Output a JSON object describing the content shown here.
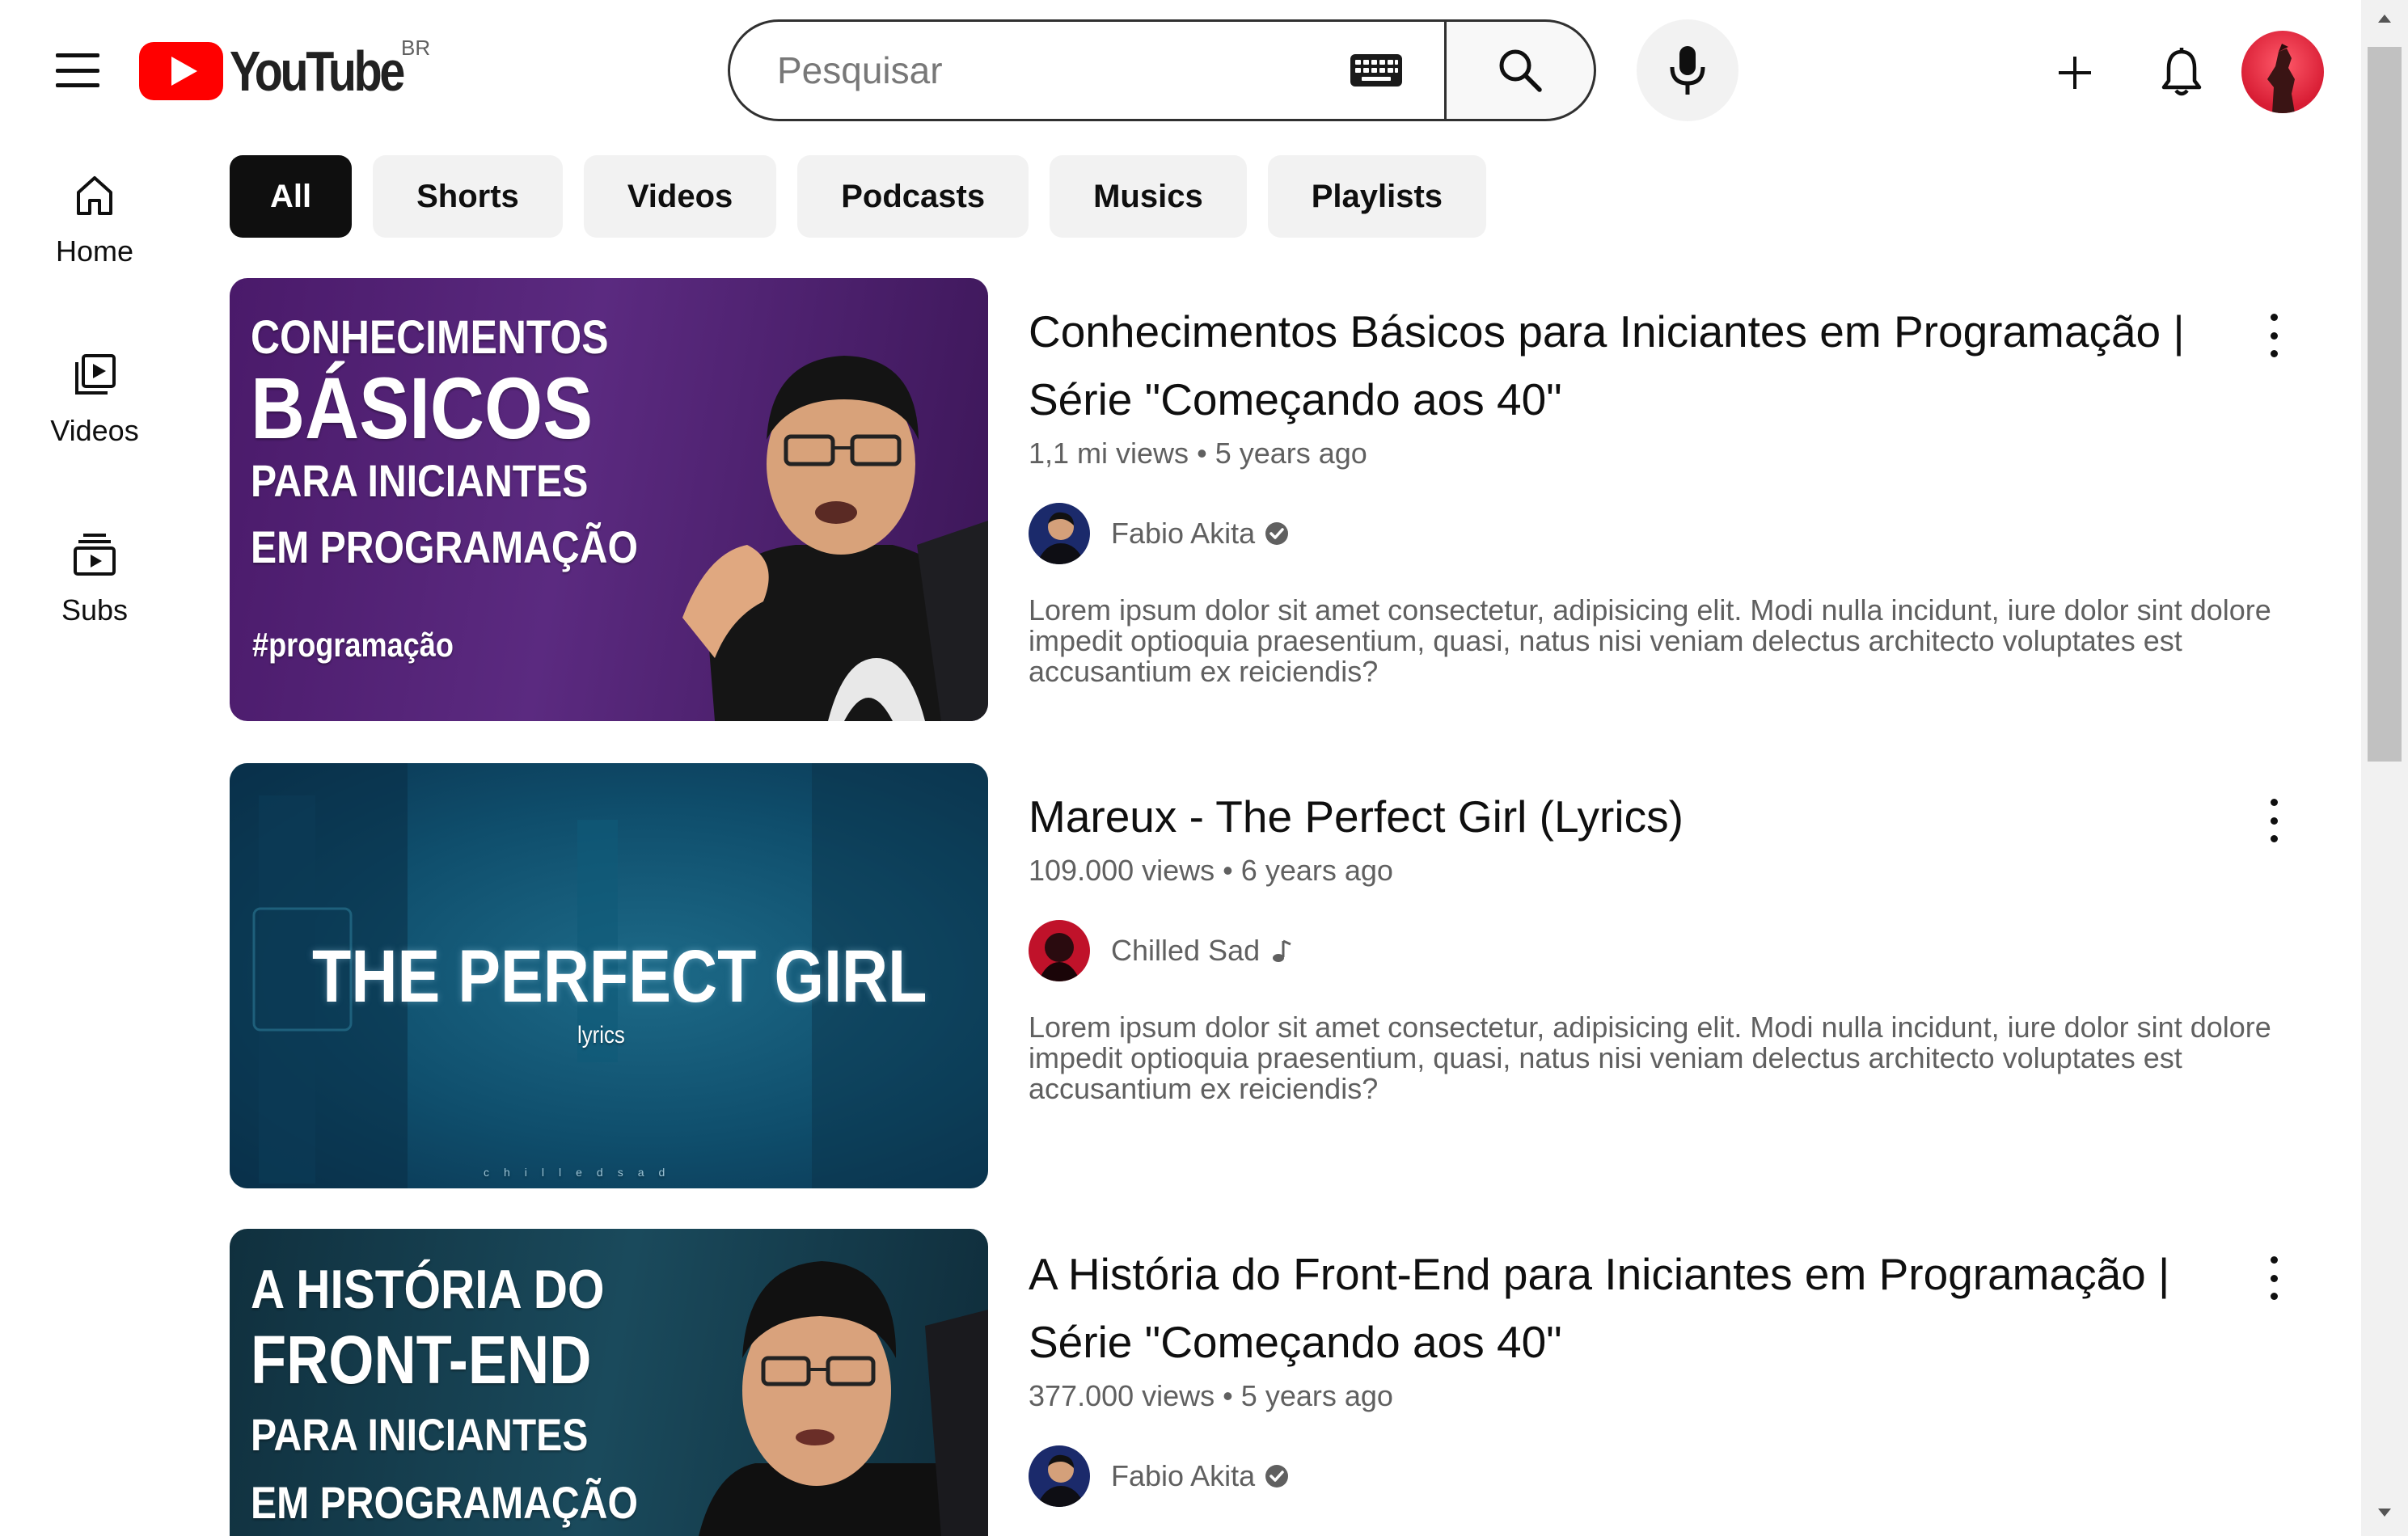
{
  "header": {
    "logo_text": "YouTube",
    "region": "BR",
    "search": {
      "placeholder": "Pesquisar",
      "value": ""
    }
  },
  "sidebar": {
    "items": [
      {
        "label": "Home",
        "icon": "home-icon"
      },
      {
        "label": "Videos",
        "icon": "videos-icon"
      },
      {
        "label": "Subs",
        "icon": "subscriptions-icon"
      }
    ]
  },
  "chips": [
    "All",
    "Shorts",
    "Videos",
    "Podcasts",
    "Musics",
    "Playlists"
  ],
  "active_chip": "All",
  "videos": [
    {
      "title_line1": "Conhecimentos Básicos para Iniciantes em Programação |",
      "title_line2": "Série \"Começando aos 40\"",
      "views": "1,1 mi views",
      "age": "5 years ago",
      "channel": "Fabio Akita",
      "channel_badge": "verified-icon",
      "description": "Lorem ipsum dolor sit amet consectetur, adipisicing elit. Modi nulla incidunt, iure dolor sint dolore impedit optioquia praesentium, quasi, natus nisi veniam delectus architecto voluptates est accusantium ex reiciendis?",
      "thumb_text": [
        "CONHECIMENTOS",
        "BÁSICOS",
        "PARA INICIANTES",
        "EM PROGRAMAÇÃO",
        "#programação"
      ]
    },
    {
      "title_line1": "Mareux - The Perfect Girl (Lyrics)",
      "title_line2": "",
      "views": "109.000 views",
      "age": "6 years ago",
      "channel": "Chilled Sad",
      "channel_badge": "music-note-icon",
      "description": "Lorem ipsum dolor sit amet consectetur, adipisicing elit. Modi nulla incidunt, iure dolor sint dolore impedit optioquia praesentium, quasi, natus nisi veniam delectus architecto voluptates est accusantium ex reiciendis?",
      "thumb_text": [
        "THE PERFECT GIRL",
        "lyrics",
        "chilledsad"
      ]
    },
    {
      "title_line1": "A História do Front-End para Iniciantes em Programação |",
      "title_line2": "Série \"Começando aos 40\"",
      "views": "377.000 views",
      "age": "5 years ago",
      "channel": "Fabio Akita",
      "channel_badge": "verified-icon",
      "description": "",
      "thumb_text": [
        "A HISTÓRIA DO",
        "FRONT-END",
        "PARA INICIANTES",
        "EM PROGRAMAÇÃO"
      ]
    }
  ],
  "meta_separator": "•",
  "colors": {
    "brand_red": "#ff0000",
    "text_primary": "#0f0f0f",
    "text_secondary": "#606060",
    "chip_bg": "#f2f2f2",
    "chip_active_bg": "#0f0f0f"
  }
}
